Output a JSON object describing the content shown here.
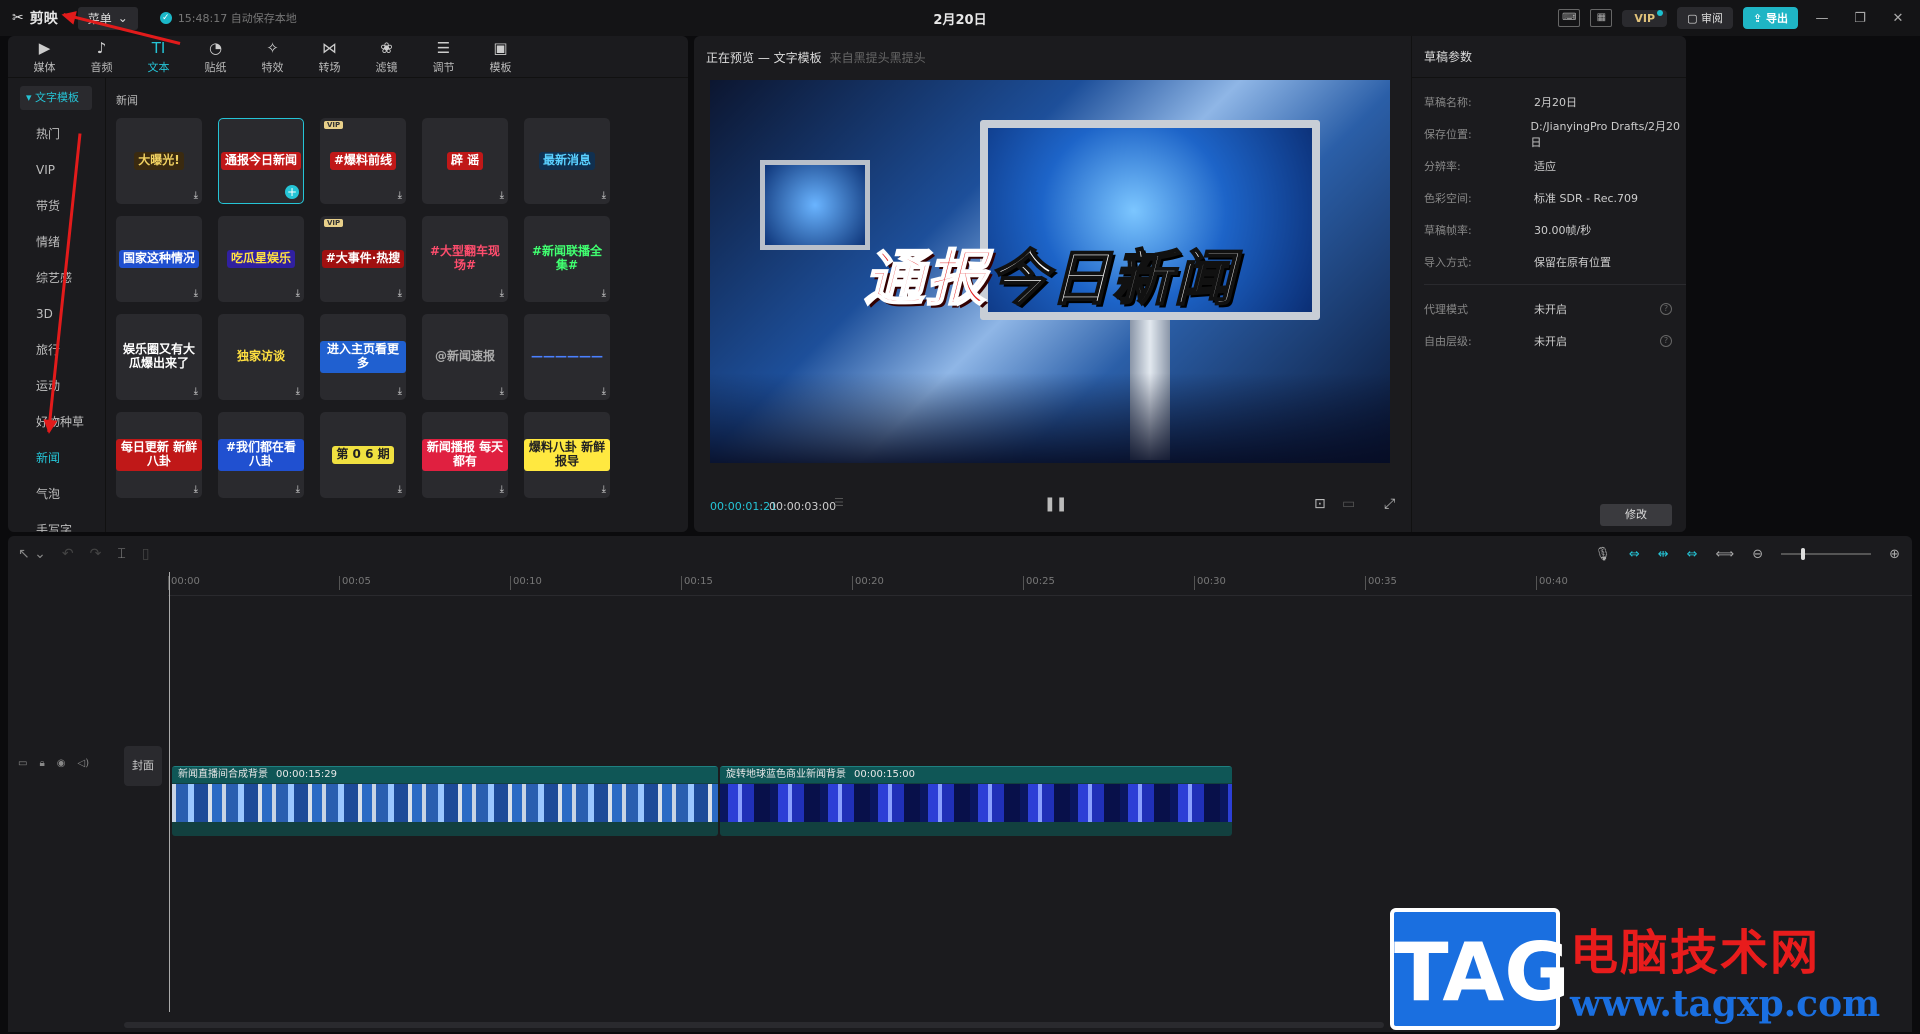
{
  "titlebar": {
    "app_name": "剪映",
    "menu_label": "菜单",
    "autosave_text": "15:48:17 自动保存本地",
    "title": "2月20日",
    "vip_label": "VIP",
    "review_label": "审阅",
    "export_label": "导出"
  },
  "toolbar": {
    "items": [
      {
        "icon": "media-icon",
        "label": "媒体"
      },
      {
        "icon": "audio-icon",
        "label": "音频"
      },
      {
        "icon": "text-icon",
        "label": "文本"
      },
      {
        "icon": "sticker-icon",
        "label": "贴纸"
      },
      {
        "icon": "effects-icon",
        "label": "特效"
      },
      {
        "icon": "transition-icon",
        "label": "转场"
      },
      {
        "icon": "filter-icon",
        "label": "滤镜"
      },
      {
        "icon": "adjust-icon",
        "label": "调节"
      },
      {
        "icon": "template-icon",
        "label": "模板"
      }
    ],
    "active_index": 2
  },
  "library": {
    "active_group": "文字模板",
    "categories": [
      "热门",
      "VIP",
      "带货",
      "情绪",
      "综艺感",
      "3D",
      "旅行",
      "运动",
      "好物种草",
      "新闻",
      "气泡",
      "手写字"
    ],
    "active_category": "新闻",
    "section_title": "新闻",
    "tiles": [
      {
        "text": "大曝光!",
        "fg": "#f0d060",
        "bg": "#3a2a10"
      },
      {
        "text": "通报今日新闻",
        "fg": "#ffffff",
        "bg": "#c01818",
        "selected": true
      },
      {
        "text": "#爆料前线",
        "fg": "#ffffff",
        "bg": "#c01818",
        "vip": true
      },
      {
        "text": "辟 谣",
        "fg": "#ffffff",
        "bg": "#c01818"
      },
      {
        "text": "最新消息",
        "fg": "#5ad0ff",
        "bg": "#103050"
      },
      {
        "text": "国家这种情况",
        "fg": "#ffffff",
        "bg": "#2050d0"
      },
      {
        "text": "吃瓜星娱乐",
        "fg": "#ffe040",
        "bg": "#3020a0"
      },
      {
        "text": "#大事件·热搜",
        "fg": "#ffffff",
        "bg": "#a01010",
        "vip": true
      },
      {
        "text": "#大型翻车现场#",
        "fg": "#ff4d6d",
        "bg": "#2a2a2e"
      },
      {
        "text": "#新闻联播全集#",
        "fg": "#40ff70",
        "bg": "#2a2a2e"
      },
      {
        "text": "娱乐圈又有大瓜爆出来了",
        "fg": "#ffffff",
        "bg": "#2a2a2e"
      },
      {
        "text": "独家访谈",
        "fg": "#ffe040",
        "bg": "#2a2a2e"
      },
      {
        "text": "进入主页看更多",
        "fg": "#ffffff",
        "bg": "#2060d0"
      },
      {
        "text": "@新闻速报",
        "fg": "#aaaaaa",
        "bg": "#2a2a2e"
      },
      {
        "text": "——————",
        "fg": "#4a80ff",
        "bg": "#2a2a2e"
      },
      {
        "text": "每日更新 新鲜八卦",
        "fg": "#ffffff",
        "bg": "#c01818"
      },
      {
        "text": "#我们都在看八卦",
        "fg": "#ffffff",
        "bg": "#2050d0"
      },
      {
        "text": "第 0 6 期",
        "fg": "#222222",
        "bg": "#f0e040"
      },
      {
        "text": "新闻播报 每天都有",
        "fg": "#ffffff",
        "bg": "#e02040"
      },
      {
        "text": "爆料八卦 新鲜报导",
        "fg": "#222222",
        "bg": "#ffe840"
      }
    ]
  },
  "preview": {
    "title": "正在预览 — 文字模板",
    "subtitle": "来自黑提头黑提头",
    "overlay_red": "通报",
    "overlay_white": "今日新闻",
    "current_time": "00:00:01:21",
    "total_time": "00:00:03:00"
  },
  "draft": {
    "title": "草稿参数",
    "rows": [
      {
        "key": "草稿名称:",
        "value": "2月20日"
      },
      {
        "key": "保存位置:",
        "value": "D:/JianyingPro Drafts/2月20日"
      },
      {
        "key": "分辨率:",
        "value": "适应"
      },
      {
        "key": "色彩空间:",
        "value": "标准 SDR - Rec.709"
      },
      {
        "key": "草稿帧率:",
        "value": "30.00帧/秒"
      },
      {
        "key": "导入方式:",
        "value": "保留在原有位置"
      }
    ],
    "extra_rows": [
      {
        "key": "代理模式",
        "value": "未开启"
      },
      {
        "key": "自由层级:",
        "value": "未开启"
      }
    ],
    "modify_label": "修改"
  },
  "timeline": {
    "ticks": [
      "00:00",
      "00:05",
      "00:10",
      "00:15",
      "00:20",
      "00:25",
      "00:30",
      "00:35",
      "00:40"
    ],
    "cover_label": "封面",
    "clips": [
      {
        "name": "新闻直播间合成背景",
        "duration": "00:00:15:29"
      },
      {
        "name": "旋转地球蓝色商业新闻背景",
        "duration": "00:00:15:00"
      }
    ]
  },
  "watermark": {
    "tag": "TAG",
    "site_name": "电脑技术网",
    "url": "www.tagxp.com"
  }
}
